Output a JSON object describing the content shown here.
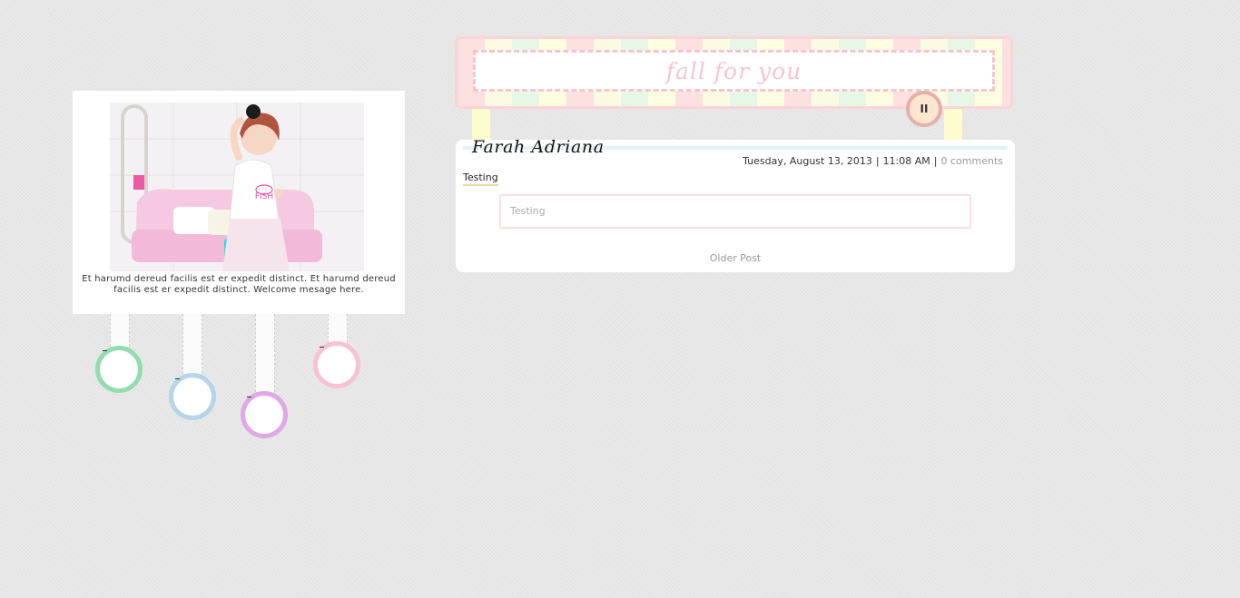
{
  "sidebar": {
    "welcome_text": "Et harumd dereud facilis est er expedit distinct. Et harumd dereud facilis est er expedit distinct. Welcome mesage here.",
    "rings": [
      {
        "color": "#92dcb0"
      },
      {
        "color": "#b5d5ea"
      },
      {
        "color": "#dfa8e6"
      },
      {
        "color": "#f8c2d6"
      }
    ]
  },
  "header": {
    "banner_title": "fall for you",
    "music_button_icon": "pause-icon",
    "music_button_glyph": "II"
  },
  "post": {
    "author": "Farah Adriana",
    "date": "Tuesday, August 13, 2013",
    "time": "11:08 AM",
    "separator": "|",
    "comments": "0 comments",
    "label": "Testing",
    "body": "Testing",
    "older_post": "Older Post"
  },
  "colors": {
    "banner_border": "#fcd3d6",
    "banner_dash": "#f9c4cc",
    "title_pink": "#f8c4d3",
    "pause_fill": "#fde6cf",
    "pause_border": "#e3b0aa"
  }
}
